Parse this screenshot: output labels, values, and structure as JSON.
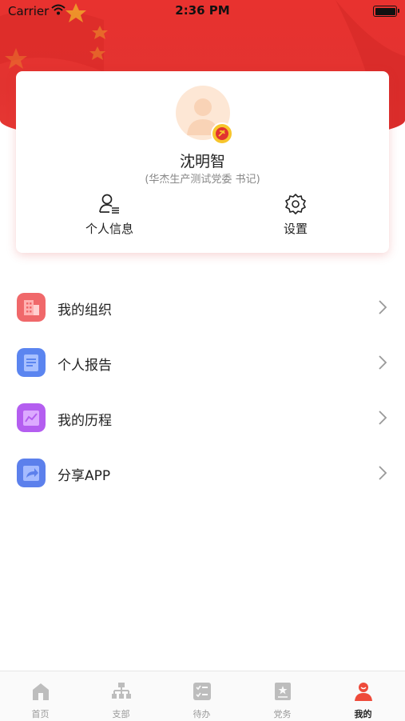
{
  "status_bar": {
    "carrier": "Carrier",
    "time": "2:36 PM"
  },
  "profile": {
    "name": "沈明智",
    "role": "(华杰生产测试党委 书记)",
    "actions": [
      {
        "label": "个人信息",
        "icon": "user-list-icon"
      },
      {
        "label": "设置",
        "icon": "gear-icon"
      }
    ]
  },
  "menu": {
    "items": [
      {
        "label": "我的组织",
        "icon": "building-icon",
        "color": "#f0686a"
      },
      {
        "label": "个人报告",
        "icon": "document-icon",
        "color": "#5b85f0"
      },
      {
        "label": "我的历程",
        "icon": "chart-icon",
        "color": "#b45ef0"
      },
      {
        "label": "分享APP",
        "icon": "share-icon",
        "color": "#5c80ec"
      }
    ]
  },
  "tabbar": {
    "tabs": [
      {
        "label": "首页",
        "icon": "home-icon"
      },
      {
        "label": "支部",
        "icon": "org-tree-icon"
      },
      {
        "label": "待办",
        "icon": "checklist-icon"
      },
      {
        "label": "党务",
        "icon": "book-star-icon"
      },
      {
        "label": "我的",
        "icon": "person-icon",
        "active": true
      }
    ]
  },
  "colors": {
    "accent": "#e23330",
    "inactive": "#999999"
  }
}
